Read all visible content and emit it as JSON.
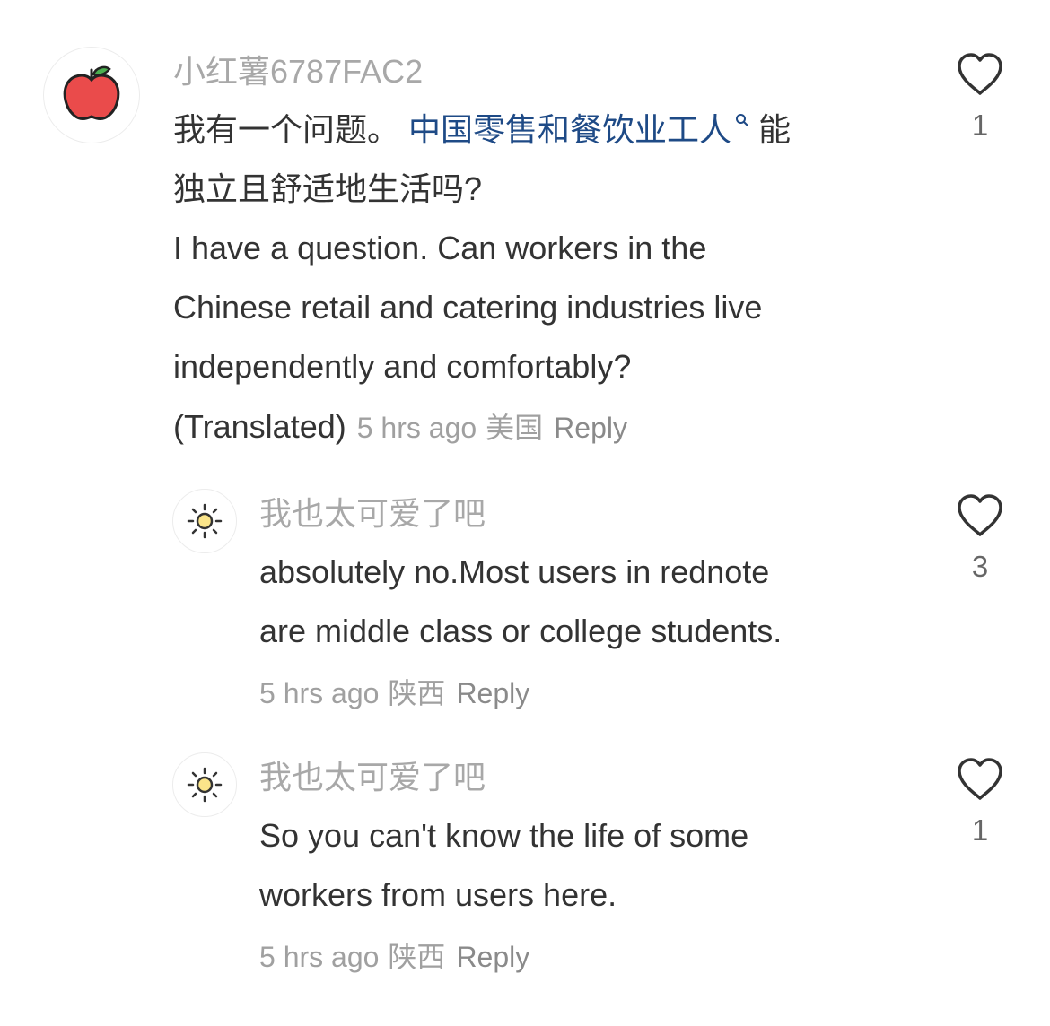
{
  "comments": [
    {
      "username": "小红薯6787FAC2",
      "avatar_icon": "apple-icon",
      "text_cn_prefix": "我有一个问题。",
      "text_cn_tag": "中国零售和餐饮业工人",
      "text_cn_suffix": "能",
      "text_cn_line2": "独立且舒适地生活吗?",
      "text_en_line1": "I have a question. Can workers in the",
      "text_en_line2": "Chinese retail and catering industries live",
      "text_en_line3": "independently and comfortably?",
      "translated_label": "(Translated)",
      "time": "5 hrs ago",
      "location": "美国",
      "reply_label": "Reply",
      "likes": "1"
    },
    {
      "username": "我也太可爱了吧",
      "avatar_icon": "sun-icon",
      "text_line1": "absolutely no.Most users in rednote",
      "text_line2": "are middle class or college students.",
      "time": "5 hrs ago",
      "location": "陕西",
      "reply_label": "Reply",
      "likes": "3"
    },
    {
      "username": "我也太可爱了吧",
      "avatar_icon": "sun-icon",
      "text_line1": "So you can't know the life of some",
      "text_line2": "workers from users here.",
      "time": "5 hrs ago",
      "location": "陕西",
      "reply_label": "Reply",
      "likes": "1"
    }
  ],
  "colors": {
    "tag": "#1e4a86",
    "username": "#a8a8a8",
    "text": "#333333",
    "meta": "#a0a0a0"
  }
}
